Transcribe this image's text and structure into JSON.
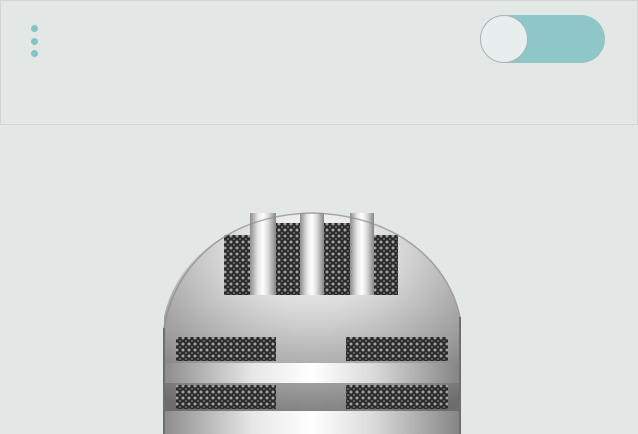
{
  "header": {
    "menu_icon": "vertical-ellipsis-icon",
    "toggle": {
      "state": "off",
      "track_color": "#8fc6c8",
      "knob_color": "#e8eded"
    }
  },
  "main": {
    "microphone_icon": "microphone-icon"
  },
  "colors": {
    "background": "#e3e8e7",
    "accent": "#84c3c6"
  }
}
